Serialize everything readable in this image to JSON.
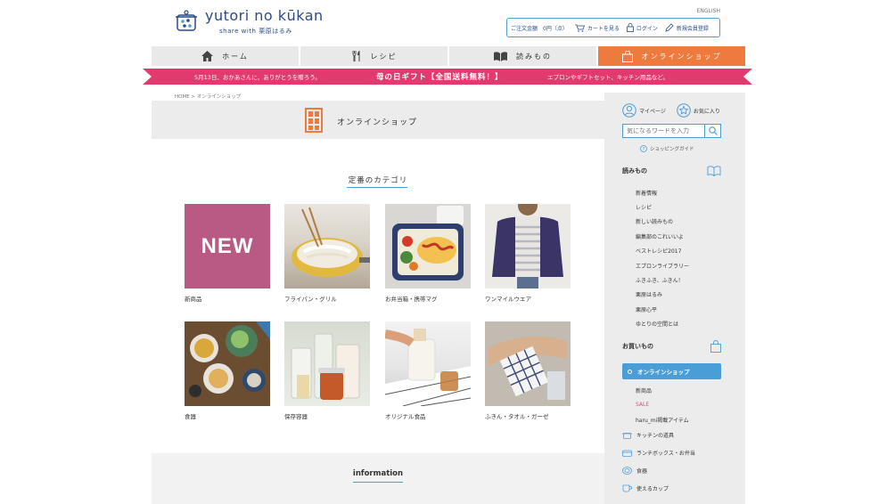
{
  "header": {
    "logo_title": "yutori no kūkan",
    "logo_sub": "share with 栗原はるみ",
    "lang_link": "ENGLISH",
    "account": {
      "order_total": "ご注文金額　0円（点）",
      "cart": "カートを見る",
      "login": "ログイン",
      "register": "新規会員登録"
    }
  },
  "nav": {
    "items": [
      {
        "label": "ホーム",
        "icon": "home-icon"
      },
      {
        "label": "レシピ",
        "icon": "fork-knife-icon"
      },
      {
        "label": "読みもの",
        "icon": "book-icon"
      },
      {
        "label": "オンラインショップ",
        "icon": "shopping-bag-icon"
      }
    ],
    "active_index": 3
  },
  "banner": {
    "left": "5月13日、おかあさんに、ありがとうを贈ろう。",
    "center": "母の日ギフト【全国送料無料！】",
    "right": "エプロンやギフトセット、キッチン用品など。"
  },
  "breadcrumb": "HOME > オンラインショップ",
  "page": {
    "title": "オンラインショップ",
    "section_heading": "定番のカテゴリ",
    "info_heading": "information"
  },
  "categories": [
    {
      "label": "新商品",
      "badge": "NEW"
    },
    {
      "label": "フライパン・グリル"
    },
    {
      "label": "お弁当箱・携帯マグ"
    },
    {
      "label": "ワンマイルウエア"
    },
    {
      "label": "食器"
    },
    {
      "label": "保存容器"
    },
    {
      "label": "オリジナル食品"
    },
    {
      "label": "ふきん・タオル・ガーゼ"
    }
  ],
  "sidebar": {
    "mypage": "マイページ",
    "favorites": "お気に入り",
    "search_placeholder": "気になるワードを入力",
    "shopping_guide": "ショッピングガイド",
    "reading_heading": "読みもの",
    "reading_links": [
      "新着情報",
      "レシピ",
      "新しい読みもの",
      "編集部のこれいいよ",
      "ベストレシピ2017",
      "エプロンライブラリー",
      "ふきふき、ふきん！",
      "栗原はるみ",
      "栗原心平",
      "ゆとりの空間とは"
    ],
    "shopping_heading": "お買いもの",
    "shop_active": "オンラインショップ",
    "shop_links": [
      "新商品",
      "SALE",
      "haru_mi掲載アイテム"
    ],
    "shop_categories": [
      "キッチンの道具",
      "ランチボックス・お弁当",
      "食器",
      "使えるカップ"
    ]
  },
  "colors": {
    "accent_blue": "#4a9ed8",
    "nav_active": "#ef7a3d",
    "banner": "#e23a6f",
    "new_badge": "#b85a84"
  }
}
